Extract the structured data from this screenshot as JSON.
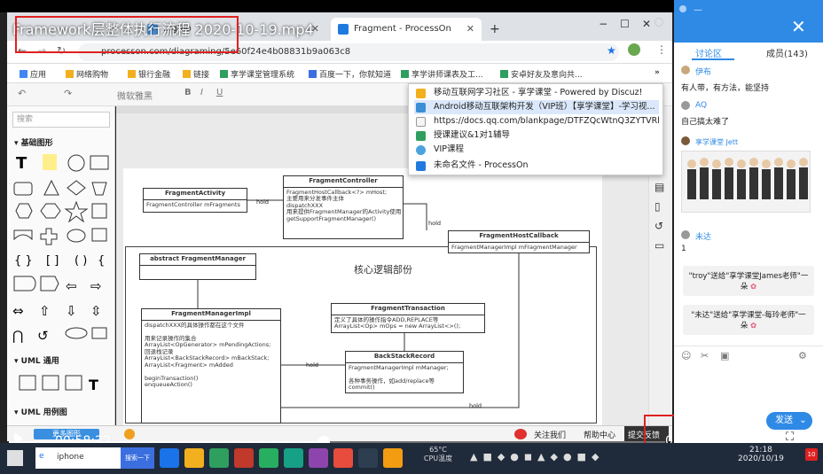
{
  "video": {
    "title": "Framework层整体执行流程 2020-10-19.mp4",
    "time_current": "00:58:22",
    "time_total": "02:01:00",
    "progress": 0.48
  },
  "browser": {
    "tab1": "...gmo",
    "tab2": "Fragment - ProcessOn",
    "new_tab": "+",
    "url": "processon.com/diagraming/5e60f24e4b08831b9a063c8",
    "bookmarks": [
      "应用",
      "网络购物",
      "银行金融",
      "链接",
      "享学课堂管理系统",
      "百度一下，你就知道",
      "享学讲师课表及工...",
      "安卓好友及意向共..."
    ],
    "more": "»"
  },
  "popup": {
    "items": [
      "移动互联网学习社区 - 享学课堂 - Powered by Discuz!",
      "Android移动互联架构开发（VIP班）【享学课堂】-学习视...",
      "https://docs.qq.com/blankpage/DTFZQcWtnQ3ZYTVRl?...",
      "授课建议&1对1辅导",
      "VIP课程",
      "未命名文件 - ProcessOn"
    ]
  },
  "toolbar": {
    "font": "微软雅黑"
  },
  "left_panel": {
    "search": "搜索",
    "sec1": "基础图形",
    "sec2": "UML 通用",
    "sec3": "UML 用例图",
    "more_btn": "更多图形"
  },
  "diagram": {
    "region_title": "核心逻辑部份",
    "fa_title": "FragmentActivity",
    "fa_body": "FragmentController mFragments",
    "fc_title": "FragmentController",
    "fc_body": "FragmentHostCallback<?> mHost;\n主要用来分发事件主体\ndispatchXXX\n用来提供FragmentManager的Activity使用\ngetSupportFragmentManager()",
    "fhc_title": "FragmentHostCallback",
    "fhc_body": "FragmentManagerImpl mFragmentManager",
    "afm_title": "abstract  FragmentManager",
    "fmi_title": "FragmentManagerImpl",
    "fmi_body": "dispatchXXX的具体操作都在这个文件\n\n用来记录操作的集合\nArrayList<OpGenerator> mPendingActions;\n回退栈记录\nArrayList<BackStackRecord> mBackStack;\nArrayList<Fragment> mAdded\n\nbeginTransaction()\nenqueueAction()",
    "ft_title": "FragmentTransaction",
    "ft_body": "定义了具体的操作指令ADD,REPLACE等\nArrayList<Op> mOps = new ArrayList<>();",
    "bsr_title": "BackStackRecord",
    "bsr_body": "FragmentManagerImpl mManager;\n\n各种事务操作，如add/replace等\ncommit()",
    "hold": "hold"
  },
  "site_bottom": {
    "follow": "关注我们",
    "help": "帮助中心",
    "feedback": "提交反馈"
  },
  "side": {
    "tab_discuss": "讨论区",
    "tab_members": "成员(143)",
    "messages": [
      {
        "name": "伊布",
        "text": "有人带，有方法，能坚持"
      },
      {
        "name": "AQ",
        "text": "自己搞太难了"
      },
      {
        "name": "享学课堂 Jett",
        "text": ""
      },
      {
        "name": "未达",
        "text": "1"
      }
    ],
    "gift1": "\"troy\"送给\"享学课堂James老师\"一朵",
    "gift2": "\"未达\"送给\"享学课堂-每玲老师\"一朵",
    "send": "发送"
  },
  "taskbar": {
    "search": "iphone",
    "search_hint": "搜索一下",
    "temp": "65°C",
    "cpu": "CPU温度",
    "time": "21:18",
    "date": "2020/10/19",
    "badge": "10"
  }
}
